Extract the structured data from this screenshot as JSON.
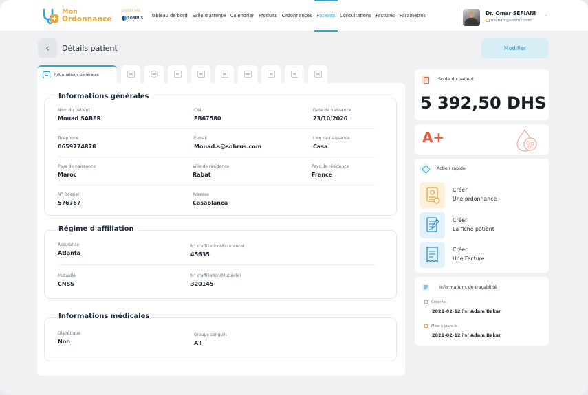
{
  "brand": {
    "line1": "Mon",
    "line2": "Ordonnance",
    "offered_by": "OFFERT PAR",
    "partner": "SOBRUS",
    "color": "#f0a832"
  },
  "nav": {
    "items": [
      {
        "label": "Tableau de bord",
        "active": false
      },
      {
        "label": "Salle d'attente",
        "active": false
      },
      {
        "label": "Calendrier",
        "active": false
      },
      {
        "label": "Produits",
        "active": false
      },
      {
        "label": "Ordonnances",
        "active": false
      },
      {
        "label": "Patients",
        "active": true
      },
      {
        "label": "Consultations",
        "active": false
      },
      {
        "label": "Factures",
        "active": false
      },
      {
        "label": "Paramètres",
        "active": false
      }
    ],
    "accent": "#2aa6d9"
  },
  "user": {
    "name": "Dr. Omar SEFIANI",
    "email": "osefiani@sobrus.com",
    "menu_icon": "chevron-down-icon"
  },
  "page": {
    "title": "Détails patient",
    "back_icon": "chevron-left-icon",
    "modify_label": "Modifier"
  },
  "tabs": {
    "active_label": "Informations générales",
    "icons": [
      "folder-icon",
      "id-card-icon",
      "history-icon",
      "pills-icon",
      "document-icon",
      "prescription-icon",
      "calendar-icon",
      "bed-icon",
      "medical-report-icon",
      "invoice-icon"
    ]
  },
  "general": {
    "title": "Informations générales",
    "nom_label": "Nom du patient",
    "nom": "Mouad SABER",
    "cin_label": "CIN",
    "cin": "EB67580",
    "naissance_label": "Date de naissance",
    "naissance": "23/10/2020",
    "tel_label": "Téléphone",
    "tel": "0659774878",
    "email_label": "E-mail",
    "email": "Mouad.s@sobrus.com",
    "lieu_label": "Lieu de naissance",
    "lieu": "Casa",
    "pays_naiss_label": "Pays de naissance",
    "pays_naiss": "Maroc",
    "ville_res_label": "Ville de résidence",
    "ville_res": "Rabat",
    "pays_res_label": "Pays de résidence",
    "pays_res": "France",
    "dossier_label": "N° Dossier",
    "dossier": "576767",
    "adresse_label": "Adresse",
    "adresse": "Casablanca"
  },
  "affiliation": {
    "title": "Régime d'affiliation",
    "assurance_label": "Assurance",
    "assurance": "Atlanta",
    "num_assurance_label": "N° d'affiliation(Assurance)",
    "num_assurance": "45635",
    "mutuelle_label": "Mutuelle",
    "mutuelle": "CNSS",
    "num_mutuelle_label": "N° d'affiliation(Mutuelle)",
    "num_mutuelle": "320145"
  },
  "medical": {
    "title": "Informations médicales",
    "diabetique_label": "Diabétique",
    "diabetique": "Non",
    "groupe_label": "Groupe sanguin",
    "groupe": "A+"
  },
  "balance": {
    "label": "Solde du patient",
    "value": "5 392,50 DHS"
  },
  "blood_group": {
    "value": "A+",
    "color": "#ea5a3a"
  },
  "quick_actions": {
    "title": "Action rapide",
    "items": [
      {
        "line1": "Créer",
        "line2": "Une ordonnance",
        "icon": "prescription-icon",
        "bg": "#fdf1dc"
      },
      {
        "line1": "Créer",
        "line2": "La fiche patient",
        "icon": "patient-file-icon",
        "bg": "#e3f2fa"
      },
      {
        "line1": "Créer",
        "line2": "Une Facture",
        "icon": "invoice-icon",
        "bg": "#e3f2fa"
      }
    ]
  },
  "traceability": {
    "title": "Informations de traçabilité",
    "created_label": "Créer le :",
    "created_date": "2021-02-12",
    "created_by_word": "Par",
    "created_by": "Adam Bakar",
    "updated_label": "Mise à jours le :",
    "updated_date": "2021-02-12",
    "updated_by_word": "Par",
    "updated_by": "Adam Bakar"
  }
}
